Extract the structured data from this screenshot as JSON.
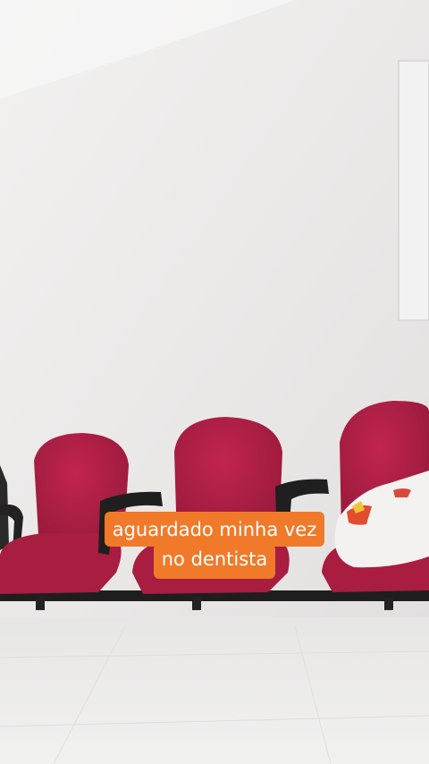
{
  "caption": {
    "line1": "aguardado minha vez",
    "line2": "no dentista",
    "background_color": "#f07a2a",
    "text_color": "#ffffff"
  },
  "scene": {
    "wall_color": "#ecebea",
    "seat_color": "#b31f45",
    "floor_color": "#eeeeee"
  }
}
